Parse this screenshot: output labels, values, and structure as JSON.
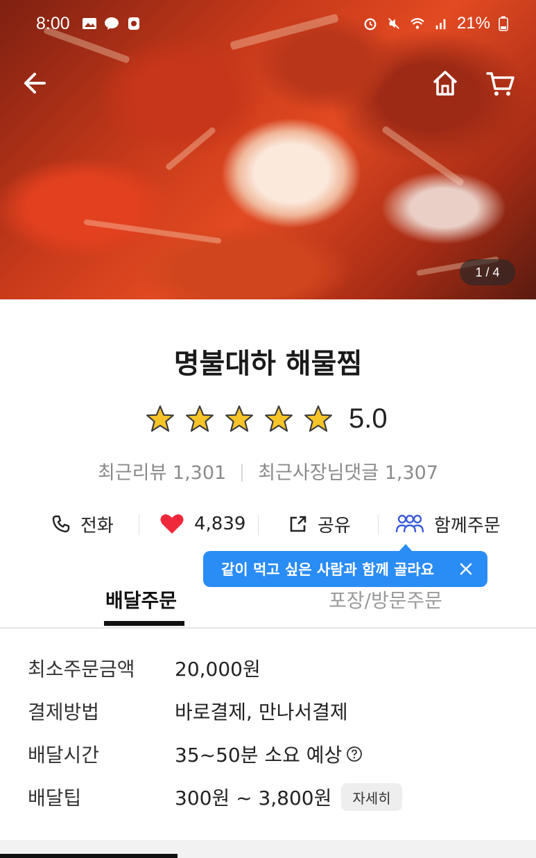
{
  "status_bar": {
    "time": "8:00",
    "battery": "21%",
    "left_icons": [
      "image-icon",
      "kakaotalk-icon",
      "app-notification-icon"
    ],
    "right_icons": [
      "alarm-icon",
      "mute-icon",
      "wifi-icon",
      "signal-icon",
      "battery-icon"
    ]
  },
  "hero": {
    "page_indicator": "1 / 4",
    "buttons": [
      "back-arrow-icon",
      "home-icon",
      "cart-icon"
    ]
  },
  "store": {
    "name": "명불대하 해물찜",
    "rating": "5.0",
    "stars_filled": 5,
    "stars_total": 5,
    "recent_reviews": "최근리뷰 1,301",
    "owner_replies": "최근사장님댓글 1,307"
  },
  "actions": {
    "phone": "전화",
    "likes": "4,839",
    "share": "공유",
    "group_order": "함께주문"
  },
  "tooltip": {
    "text": "같이 먹고 싶은 사람과 함께 골라요"
  },
  "tabs": {
    "delivery": "배달주문",
    "pickup": "포장/방문주문"
  },
  "details": {
    "min_order_label": "최소주문금액",
    "min_order_value": "20,000원",
    "payment_label": "결제방법",
    "payment_value": "바로결제, 만나서결제",
    "time_label": "배달시간",
    "time_value": "35~50분 소요 예상",
    "tip_label": "배달팁",
    "tip_value": "300원 ~ 3,800원",
    "tip_detail_button": "자세히"
  },
  "colors": {
    "accent_blue": "#2a8cf5",
    "star_yellow": "#f6c328",
    "heart_red": "#f0283c"
  }
}
